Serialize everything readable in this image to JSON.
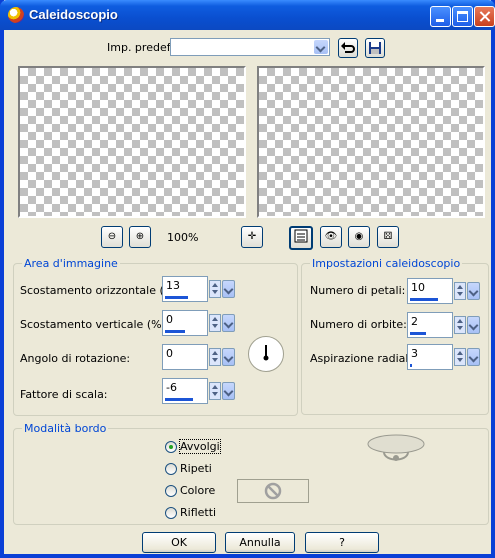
{
  "window": {
    "title": "Caleidoscopio"
  },
  "presets": {
    "label": "Imp. predef.:",
    "value": ""
  },
  "zoom": {
    "level": "100%"
  },
  "area": {
    "title": "Area d'immagine",
    "h_offset": {
      "label": "Scostamento orizzontale (%):",
      "value": "13",
      "fill": 0.57
    },
    "v_offset": {
      "label": "Scostamento verticale (%):",
      "value": "0",
      "fill": 0.5
    },
    "rotation": {
      "label": "Angolo di rotazione:",
      "value": "0",
      "fill": 0
    },
    "scale": {
      "label": "Fattore di scala:",
      "value": "-6",
      "fill": 0.7
    }
  },
  "kaleido": {
    "title": "Impostazioni caleidoscopio",
    "petals": {
      "label": "Numero di petali:",
      "value": "10",
      "fill": 0.7
    },
    "orbits": {
      "label": "Numero di orbite:",
      "value": "2",
      "fill": 0.4
    },
    "radial": {
      "label": "Aspirazione radiale:",
      "value": "3",
      "fill": 0.05
    }
  },
  "edge": {
    "title": "Modalità bordo",
    "options": [
      "Avvolgi",
      "Ripeti",
      "Colore",
      "Rifletti"
    ],
    "selected": 0
  },
  "buttons": {
    "ok": "OK",
    "cancel": "Annulla",
    "help": "?"
  },
  "colors": {
    "accent": "#0046d5",
    "titlebar": "#0a4fd0",
    "face": "#ece9d8"
  }
}
